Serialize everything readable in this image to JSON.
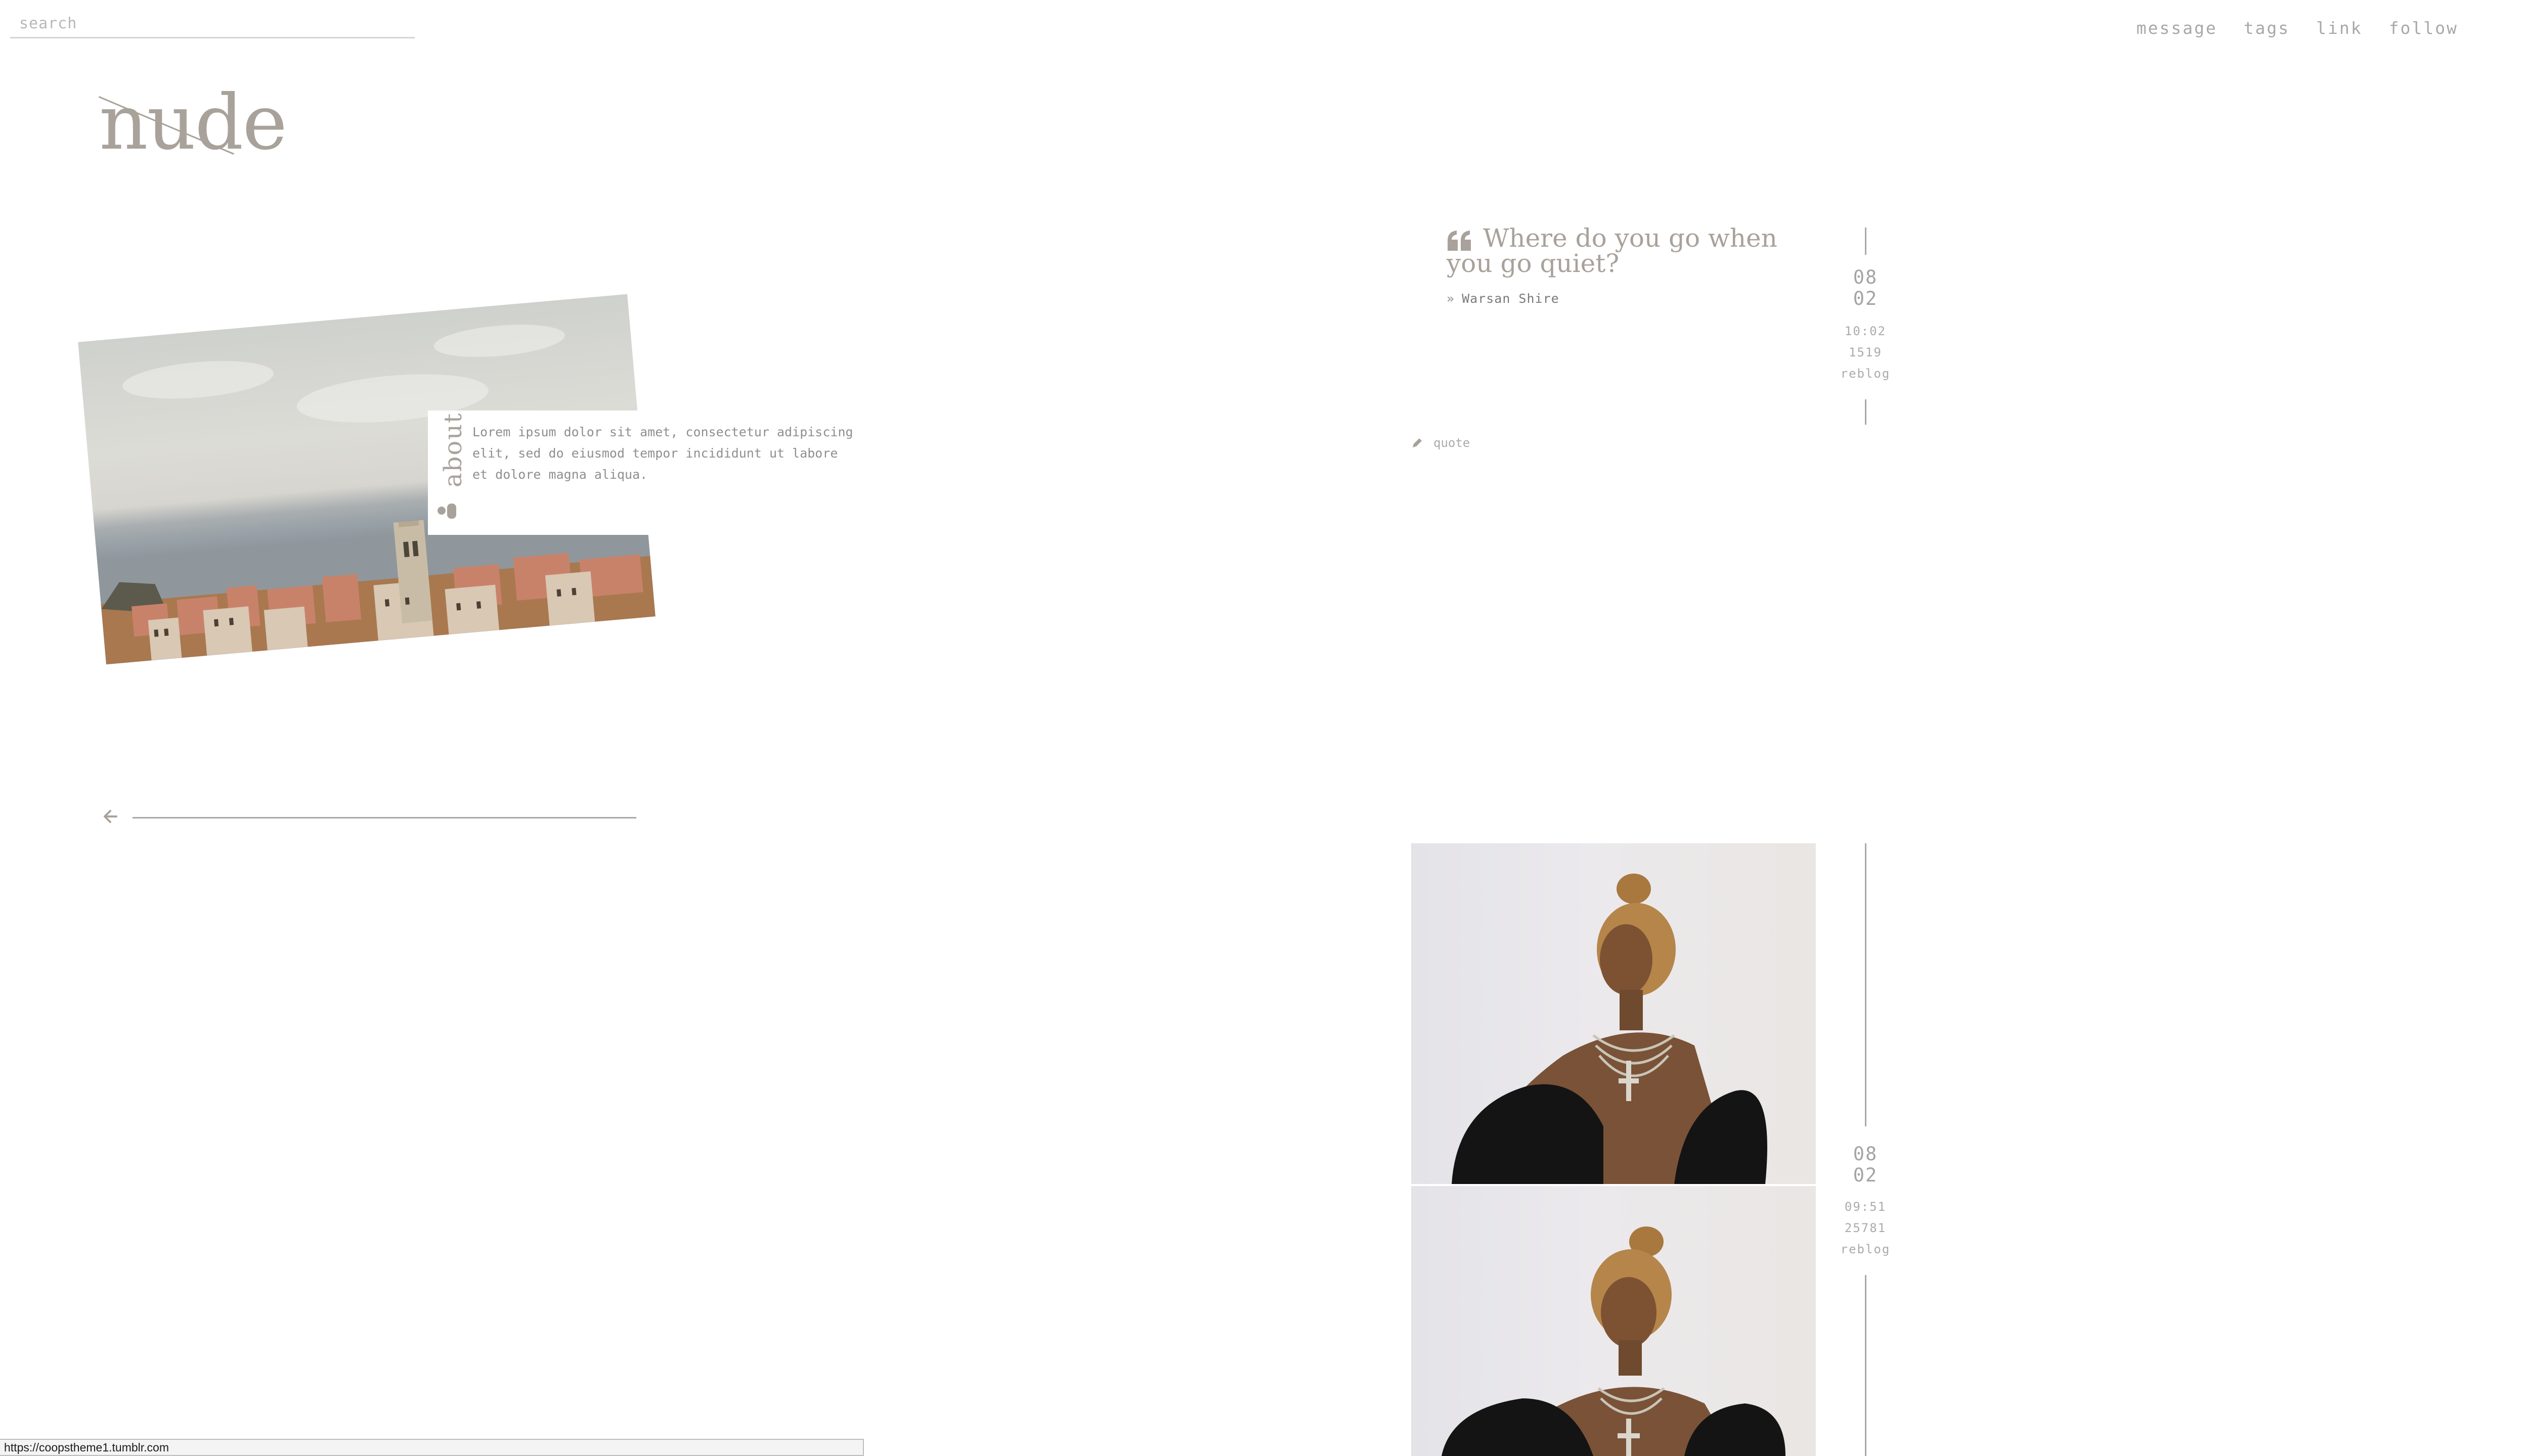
{
  "search": {
    "placeholder": "search"
  },
  "nav": {
    "items": [
      "message",
      "tags",
      "link",
      "follow"
    ]
  },
  "logo": {
    "text": "nude"
  },
  "about": {
    "label": "about",
    "text": "Lorem ipsum dolor sit amet, consectetur adipiscing elit, sed do eiusmod tempor incididunt ut labore et dolore magna aliqua."
  },
  "posts": [
    {
      "type": "quote",
      "quote": "Where do you go when you go quiet?",
      "source": "Warsan Shire",
      "date_month": "08",
      "date_day": "02",
      "time": "10:02",
      "notes": "1519",
      "reblog": "reblog",
      "tag": "quote"
    },
    {
      "type": "photoset",
      "date_month": "08",
      "date_day": "02",
      "time": "09:51",
      "notes": "25781",
      "reblog": "reblog"
    }
  ],
  "statusbar": {
    "url": "https://coopstheme1.tumblr.com"
  },
  "colors": {
    "accent": "#a8a29a",
    "text": "#8f8f8f",
    "line": "#a8a8a8"
  }
}
